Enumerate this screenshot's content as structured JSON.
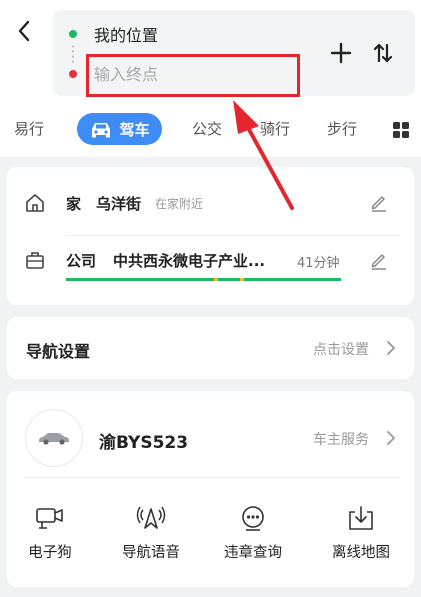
{
  "route": {
    "origin_label": "我的位置",
    "destination_placeholder": "输入终点"
  },
  "tabs": [
    {
      "label": "易行"
    },
    {
      "label": "驾车",
      "selected": true
    },
    {
      "label": "公交"
    },
    {
      "label": "骑行"
    },
    {
      "label": "步行"
    }
  ],
  "favorites": {
    "home": {
      "tag": "家",
      "name": "乌洋街",
      "note": "在家附近"
    },
    "work": {
      "tag": "公司",
      "name": "中共西永微电子产业...",
      "eta": "41分钟"
    }
  },
  "nav_settings": {
    "title": "导航设置",
    "action": "点击设置"
  },
  "vehicle": {
    "plate": "渝BYS523",
    "service": "车主服务"
  },
  "tools": [
    {
      "label": "电子狗",
      "icon": "dashcam-icon"
    },
    {
      "label": "导航语音",
      "icon": "voice-broadcast-icon"
    },
    {
      "label": "违章查询",
      "icon": "violation-query-icon"
    },
    {
      "label": "离线地图",
      "icon": "offline-map-download-icon"
    }
  ],
  "colors": {
    "accent": "#3f8cf5",
    "origin_dot": "#1fb864",
    "destination_dot": "#e8303a",
    "annotation": "#e3262f",
    "traffic_smooth": "#1fb864",
    "traffic_slow": "#f7b733"
  }
}
